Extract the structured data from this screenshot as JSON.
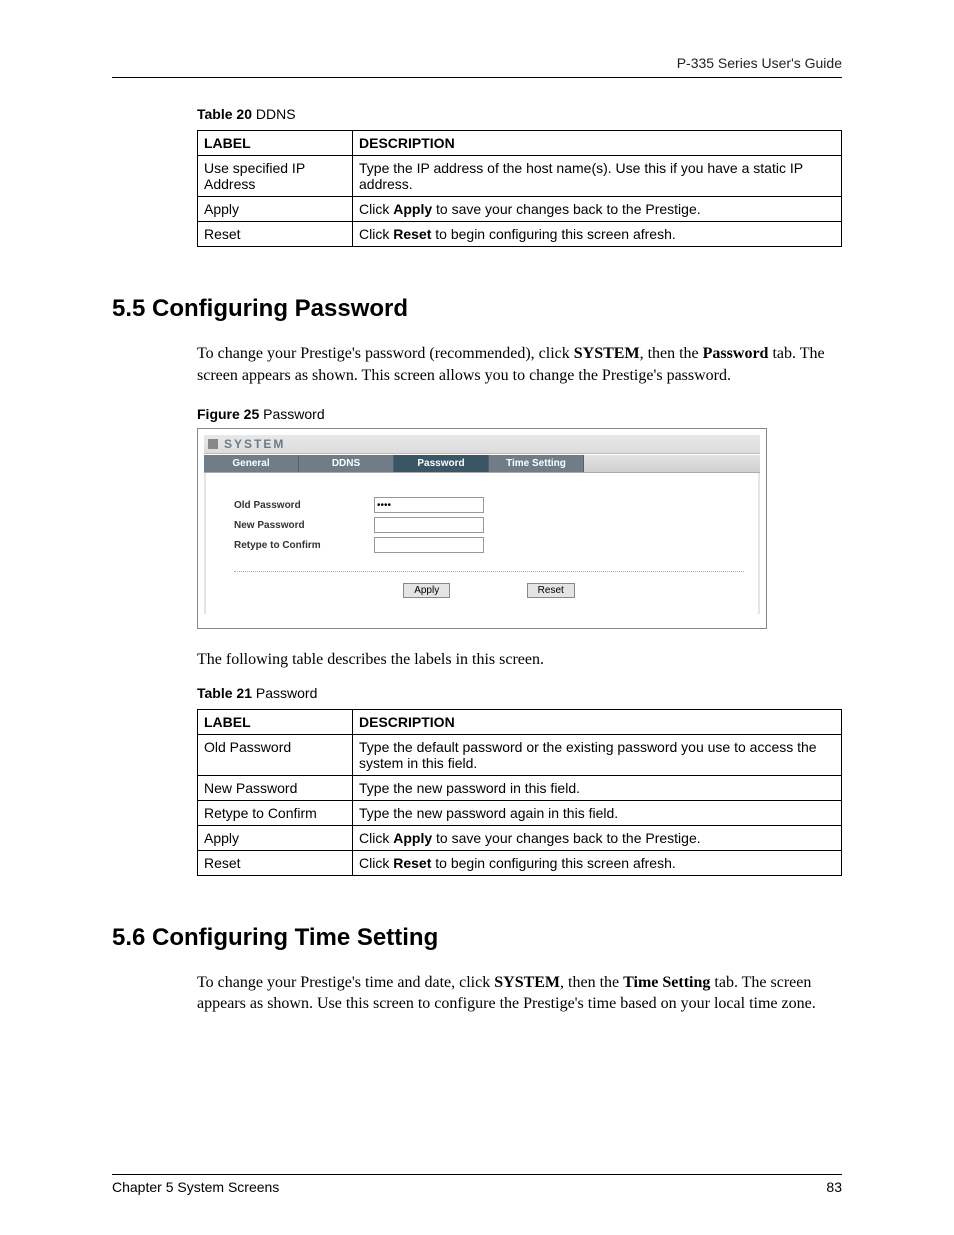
{
  "header": {
    "guide_title": "P-335 Series User's Guide"
  },
  "table20": {
    "caption_prefix": "Table 20",
    "caption_text": "   DDNS",
    "col_label": "LABEL",
    "col_desc": "DESCRIPTION",
    "rows": [
      {
        "label": "Use specified IP Address",
        "desc_pre": "Type the IP address of the host name(s). Use this if you have a static IP address.",
        "bold": "",
        "desc_post": ""
      },
      {
        "label": "Apply",
        "desc_pre": "Click ",
        "bold": "Apply",
        "desc_post": " to save your changes back to the Prestige."
      },
      {
        "label": "Reset",
        "desc_pre": "Click ",
        "bold": "Reset",
        "desc_post": " to begin configuring this screen afresh."
      }
    ]
  },
  "section55": {
    "heading": "5.5  Configuring Password",
    "para_parts": {
      "p1": "To change your Prestige's password (recommended), click ",
      "b1": "SYSTEM",
      "p2": ", then the ",
      "b2": "Password",
      "p3": " tab. The screen appears as shown. This screen allows you to change the Prestige's password."
    }
  },
  "figure25": {
    "caption_prefix": "Figure 25",
    "caption_text": "   Password",
    "sys_title": "SYSTEM",
    "tabs": [
      "General",
      "DDNS",
      "Password",
      "Time Setting"
    ],
    "active_tab_index": 2,
    "form": {
      "old_label": "Old Password",
      "old_value": "••••",
      "new_label": "New Password",
      "new_value": "",
      "retype_label": "Retype to Confirm",
      "retype_value": ""
    },
    "buttons": {
      "apply": "Apply",
      "reset": "Reset"
    }
  },
  "para_after_fig": "The following table describes the labels in this screen.",
  "table21": {
    "caption_prefix": "Table 21",
    "caption_text": "   Password",
    "col_label": "LABEL",
    "col_desc": "DESCRIPTION",
    "rows": [
      {
        "label": "Old Password",
        "desc_pre": "Type the default password or the existing password you use to access the system in this field.",
        "bold": "",
        "desc_post": ""
      },
      {
        "label": "New Password",
        "desc_pre": "Type the new password in this field.",
        "bold": "",
        "desc_post": ""
      },
      {
        "label": "Retype to Confirm",
        "desc_pre": "Type the new password again in this field.",
        "bold": "",
        "desc_post": ""
      },
      {
        "label": "Apply",
        "desc_pre": "Click ",
        "bold": "Apply",
        "desc_post": " to save your changes back to the Prestige."
      },
      {
        "label": "Reset",
        "desc_pre": "Click ",
        "bold": "Reset",
        "desc_post": " to begin configuring this screen afresh."
      }
    ]
  },
  "section56": {
    "heading": "5.6  Configuring Time Setting",
    "para_parts": {
      "p1": "To change your Prestige's time and date, click ",
      "b1": "SYSTEM",
      "p2": ", then the ",
      "b2": "Time Setting",
      "p3": " tab. The screen appears as shown. Use this screen to configure the Prestige's time based on your local time zone."
    }
  },
  "footer": {
    "chapter": "Chapter 5 System Screens",
    "page_num": "83"
  }
}
